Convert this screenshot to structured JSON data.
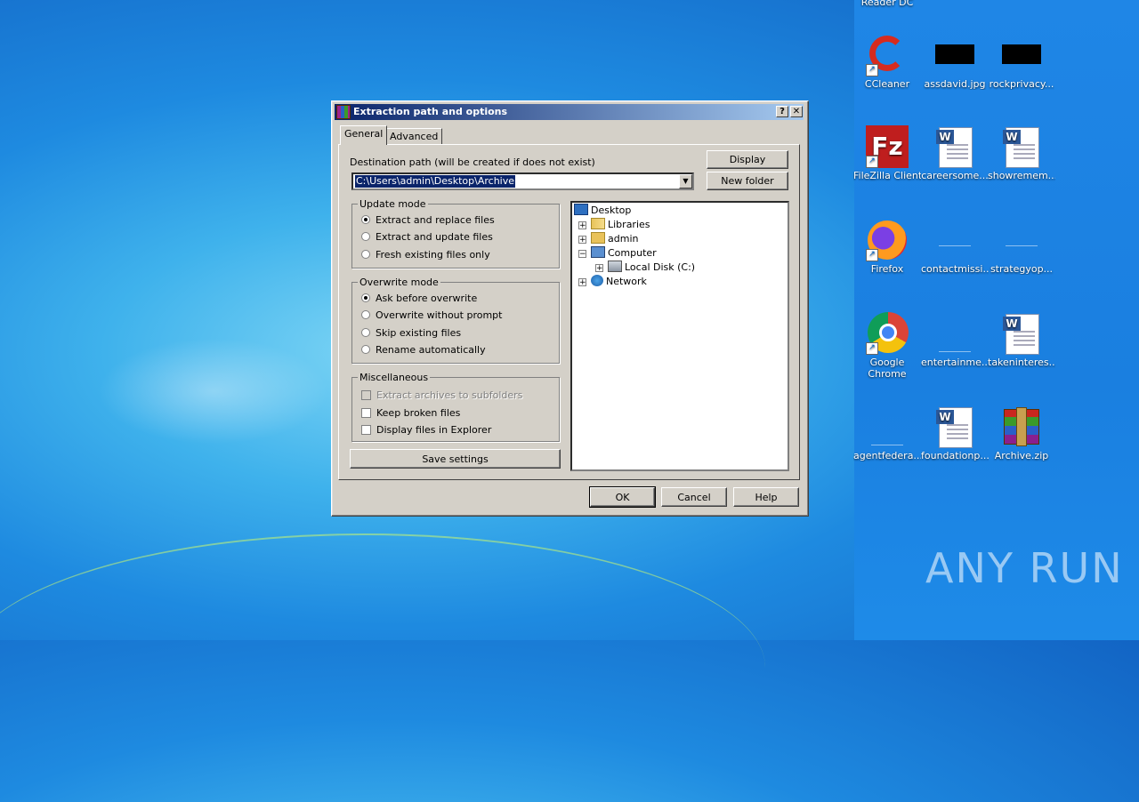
{
  "desktop": {
    "top_label": "Reader DC",
    "icons": [
      {
        "label": "CCleaner",
        "icon": "ccleaner-icon"
      },
      {
        "label": "assdavid.jpg",
        "icon": "image-file-icon"
      },
      {
        "label": "rockprivacy...",
        "icon": "image-file-icon"
      },
      {
        "label": "FileZilla Client",
        "icon": "filezilla-icon"
      },
      {
        "label": "careersome...",
        "icon": "word-document-icon"
      },
      {
        "label": "showremem...",
        "icon": "word-document-icon"
      },
      {
        "label": "Firefox",
        "icon": "firefox-icon"
      },
      {
        "label": "contactmissi...",
        "icon": "blank-file-icon"
      },
      {
        "label": "strategyop...",
        "icon": "blank-file-icon"
      },
      {
        "label": "Google Chrome",
        "icon": "chrome-icon"
      },
      {
        "label": "entertainme...",
        "icon": "blank-file-icon"
      },
      {
        "label": "takeninteres...",
        "icon": "word-document-icon"
      },
      {
        "label": "agentfedera...",
        "icon": "blank-file-icon"
      },
      {
        "label": "foundationp...",
        "icon": "word-document-icon"
      },
      {
        "label": "Archive.zip",
        "icon": "winrar-archive-icon"
      }
    ],
    "watermark": "ANY RUN"
  },
  "dialog": {
    "title": "Extraction path and options",
    "help_btn": "?",
    "close_btn": "✕",
    "tabs": [
      {
        "label": "General",
        "active": true
      },
      {
        "label": "Advanced",
        "active": false
      }
    ],
    "destination_label": "Destination path (will be created if does not exist)",
    "destination_value": "C:\\Users\\admin\\Desktop\\Archive",
    "display_btn": "Display",
    "new_folder_btn": "New folder",
    "update_mode": {
      "title": "Update mode",
      "options": [
        "Extract and replace files",
        "Extract and update files",
        "Fresh existing files only"
      ],
      "selected": 0
    },
    "overwrite_mode": {
      "title": "Overwrite mode",
      "options": [
        "Ask before overwrite",
        "Overwrite without prompt",
        "Skip existing files",
        "Rename automatically"
      ],
      "selected": 0
    },
    "misc": {
      "title": "Miscellaneous",
      "options": [
        {
          "label": "Extract archives to subfolders",
          "checked": false,
          "disabled": true
        },
        {
          "label": "Keep broken files",
          "checked": false,
          "disabled": false
        },
        {
          "label": "Display files in Explorer",
          "checked": false,
          "disabled": false
        }
      ]
    },
    "save_settings_btn": "Save settings",
    "tree": [
      {
        "label": "Desktop",
        "expander": ""
      },
      {
        "label": "Libraries",
        "expander": "+"
      },
      {
        "label": "admin",
        "expander": "+"
      },
      {
        "label": "Computer",
        "expander": "−"
      },
      {
        "label": "Local Disk (C:)",
        "expander": "+"
      },
      {
        "label": "Network",
        "expander": "+"
      }
    ],
    "ok_btn": "OK",
    "cancel_btn": "Cancel",
    "help_button": "Help"
  }
}
